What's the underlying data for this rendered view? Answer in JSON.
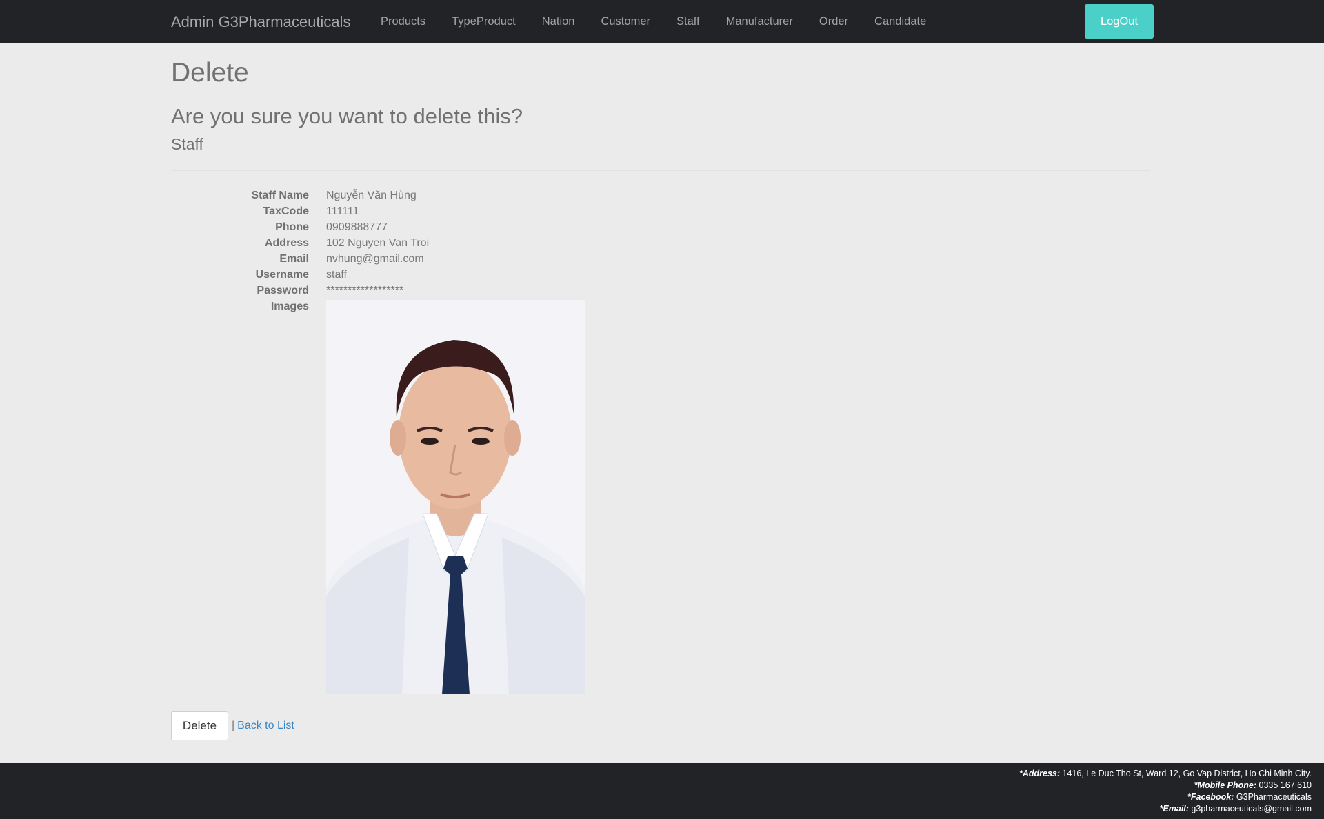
{
  "navbar": {
    "brand": "Admin G3Pharmaceuticals",
    "items": [
      {
        "label": "Products"
      },
      {
        "label": "TypeProduct"
      },
      {
        "label": "Nation"
      },
      {
        "label": "Customer"
      },
      {
        "label": "Staff"
      },
      {
        "label": "Manufacturer"
      },
      {
        "label": "Order"
      },
      {
        "label": "Candidate"
      }
    ],
    "logout_label": "LogOut"
  },
  "page": {
    "title": "Delete",
    "confirm_question": "Are you sure you want to delete this?",
    "entity": "Staff"
  },
  "details": {
    "staff_name": {
      "label": "Staff Name",
      "value": "Nguyễn Văn Hùng"
    },
    "taxcode": {
      "label": "TaxCode",
      "value": "111111"
    },
    "phone": {
      "label": "Phone",
      "value": "0909888777"
    },
    "address": {
      "label": "Address",
      "value": "102 Nguyen Van Troi"
    },
    "email": {
      "label": "Email",
      "value": "nvhung@gmail.com"
    },
    "username": {
      "label": "Username",
      "value": "staff"
    },
    "password": {
      "label": "Password",
      "value": "******************"
    },
    "images": {
      "label": "Images"
    }
  },
  "actions": {
    "delete_label": "Delete",
    "separator": "|",
    "back_label": "Back to List"
  },
  "footer": {
    "address_label": "*Address:",
    "address_value": "1416, Le Duc Tho St, Ward 12, Go Vap District, Ho Chi Minh City.",
    "phone_label": "*Mobile Phone:",
    "phone_value": "0335 167 610",
    "facebook_label": "*Facebook:",
    "facebook_value": "G3Pharmaceuticals",
    "email_label": "*Email:",
    "email_value": "g3pharmaceuticals@gmail.com"
  },
  "colors": {
    "navbar_bg": "#222327",
    "page_bg": "#ebebeb",
    "logout_bg": "#4bd0c9",
    "link": "#3a87c7"
  }
}
